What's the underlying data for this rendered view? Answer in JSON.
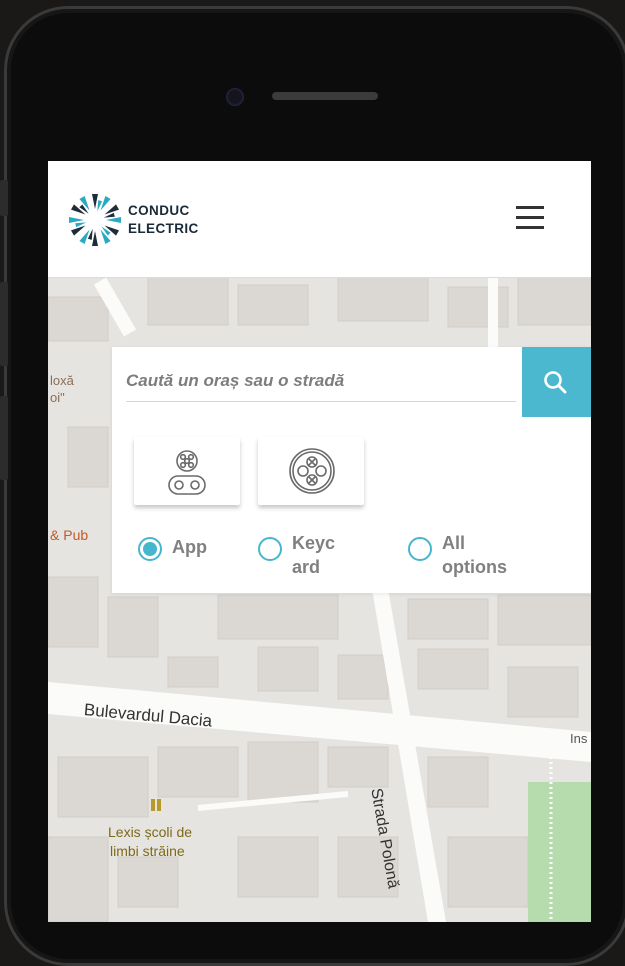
{
  "header": {
    "brand_line1": "CONDUC",
    "brand_line2": "ELECTRIC"
  },
  "search": {
    "placeholder": "Caută un oraș sau o stradă",
    "value": ""
  },
  "connectors": [
    {
      "name": "connector-type-2"
    },
    {
      "name": "connector-round"
    }
  ],
  "access_filter": {
    "selected": "App",
    "options": [
      {
        "label": "App",
        "selected": true
      },
      {
        "label": "Keycard",
        "selected": false
      },
      {
        "label": "All options",
        "selected": false
      }
    ]
  },
  "map": {
    "labels": {
      "top_left_1": "loxă",
      "top_left_2": "oi\"",
      "pub": "& Pub",
      "boulevard": "Bulevardul Dacia",
      "street": "Strada Polonă",
      "edge": "Ins",
      "school_1": "Lexis școli de",
      "school_2": "limbi străine"
    }
  },
  "colors": {
    "accent": "#4bb8cf",
    "brand_text": "#1b2a38",
    "map_bg": "#e6e4e0",
    "park_green": "#b6dcae",
    "poi_orange": "#c05a2a",
    "poi_olive": "#7d6a18"
  }
}
